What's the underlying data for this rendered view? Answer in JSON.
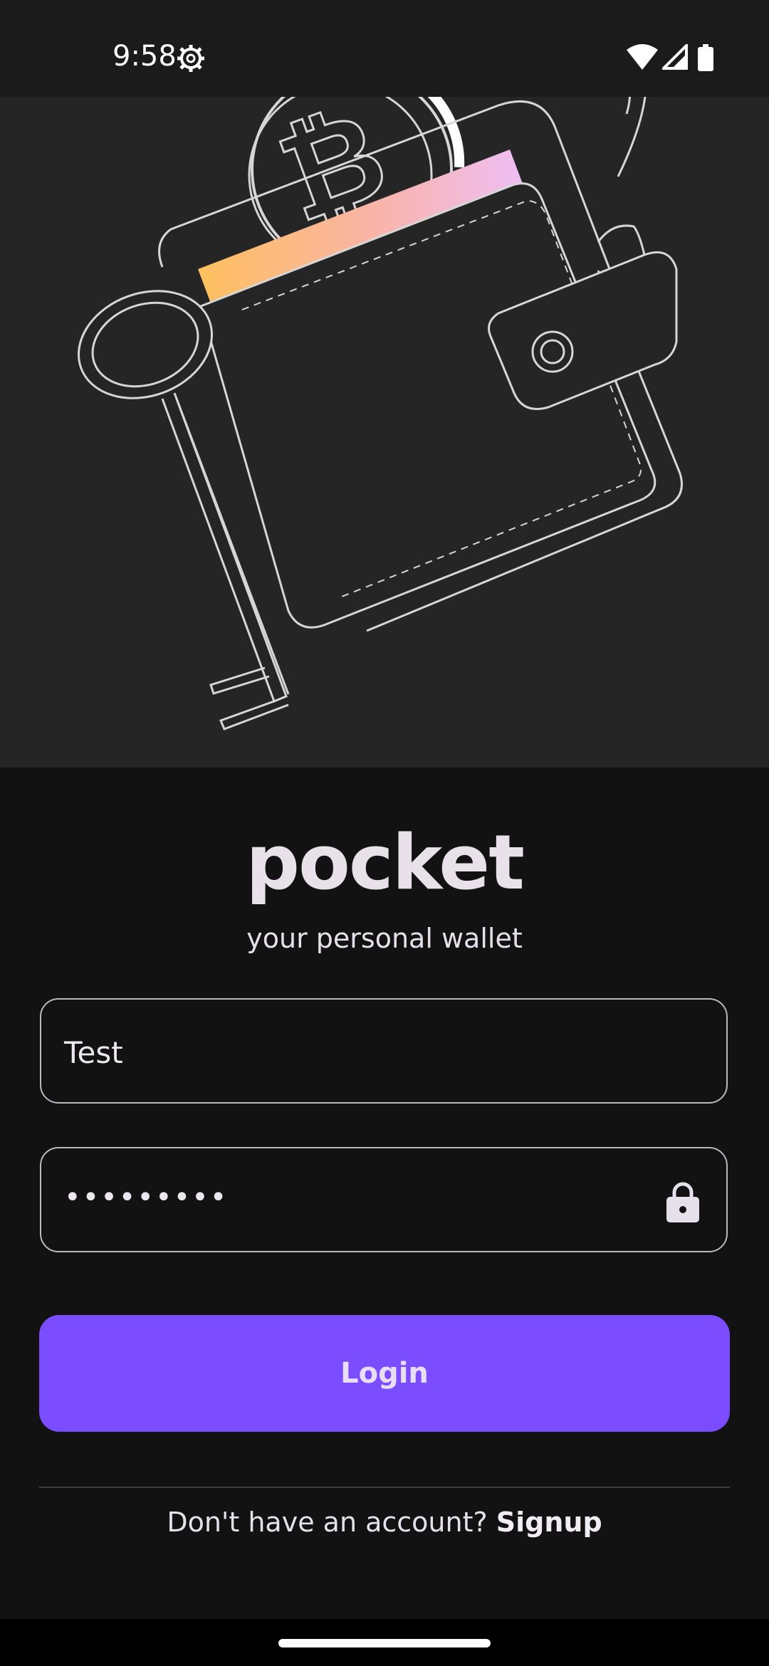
{
  "status_bar": {
    "time": "9:58",
    "icons": [
      "settings-gear-icon",
      "wifi-icon",
      "cell-signal-icon",
      "battery-icon"
    ]
  },
  "hero": {
    "illustration": "wallet-with-bitcoin-card-and-key",
    "icons": [
      "bitcoin-coin-icon",
      "wallet-icon",
      "key-icon"
    ]
  },
  "brand": {
    "title": "pocket",
    "subtitle": "your personal wallet"
  },
  "form": {
    "username_value": "Test",
    "password_value": "•••••••••",
    "password_icon": "lock-icon",
    "login_label": "Login"
  },
  "footer": {
    "prompt": "Don't have an account?",
    "signup_label": "Signup"
  },
  "colors": {
    "background": "#121212",
    "hero_background": "#252525",
    "accent": "#7c4dff",
    "card_gradient_start": "#ffc05e",
    "card_gradient_end": "#eebef4"
  }
}
